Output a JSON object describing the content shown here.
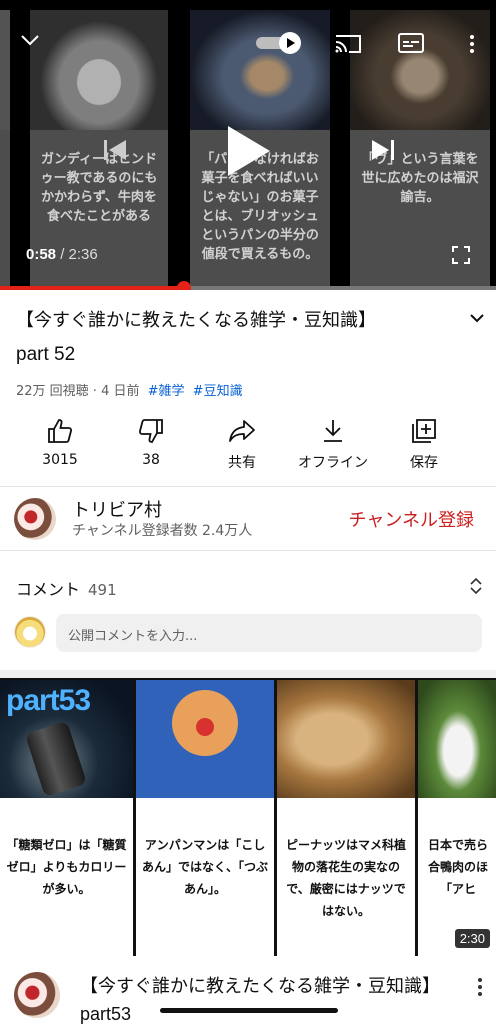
{
  "player": {
    "frames": [
      {
        "caption": ""
      },
      {
        "caption": "ガンディーはヒンドゥー教であるのにもかかわらず、牛肉を食べたことがある"
      },
      {
        "caption": "「パンがなければお菓子を食べればいいじゃない」のお菓子とは、ブリオッシュというパンの半分の値段で買えるもの。"
      },
      {
        "caption": "「ヴ」という言葉を世に広めたのは福沢諭吉。"
      }
    ],
    "current_time": "0:58",
    "separator": " / ",
    "total_time": "2:36",
    "progress": 0.37
  },
  "video": {
    "title": "【今すぐ誰かに教えたくなる雑学・豆知識】",
    "subtitle": "part 52",
    "views_date": "22万 回視聴 · 4 日前",
    "tags": [
      "#雑学",
      "#豆知識"
    ]
  },
  "actions": [
    {
      "id": "like",
      "label": "3015",
      "icon": "thumbs-up-icon"
    },
    {
      "id": "dislike",
      "label": "38",
      "icon": "thumbs-down-icon"
    },
    {
      "id": "share",
      "label": "共有",
      "icon": "share-icon"
    },
    {
      "id": "offline",
      "label": "オフライン",
      "icon": "download-icon"
    },
    {
      "id": "save",
      "label": "保存",
      "icon": "playlist-add-icon"
    }
  ],
  "channel": {
    "name": "トリビア村",
    "subscribers": "チャンネル登録者数 2.4万人",
    "subscribe_label": "チャンネル登録",
    "subscribe_color": "#cc1f1f"
  },
  "comments": {
    "heading": "コメント",
    "count": "491",
    "placeholder": "公開コメントを入力..."
  },
  "next_video": {
    "badge": "part53",
    "panels": [
      {
        "caption": "「糖類ゼロ」は「糖質ゼロ」よりもカロリーが多い。"
      },
      {
        "caption": "アンパンマンは「こしあん」ではなく、「つぶあん」。"
      },
      {
        "caption": "ピーナッツはマメ科植物の落花生の実なので、厳密にはナッツではない。"
      },
      {
        "caption": "日本で売ら合鴨肉のほ「アヒ"
      }
    ],
    "duration": "2:30",
    "title": "【今すぐ誰かに教えたくなる雑学・豆知識】part53"
  },
  "colors": {
    "accent_red": "#e62117",
    "link_blue": "#065fd4"
  }
}
